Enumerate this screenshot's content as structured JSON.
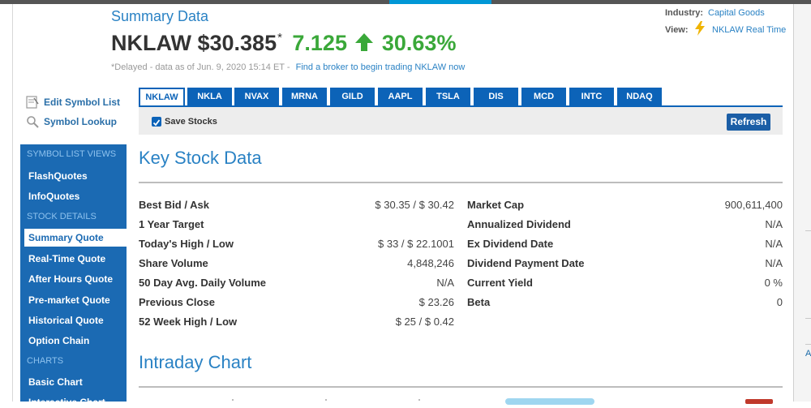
{
  "header": {
    "section_title": "Summary Data",
    "symbol_price": "NKLAW $30.385",
    "delayed_marker": "*",
    "change": "7.125",
    "change_pct": "30.63%",
    "delayed_text": "*Delayed - data as of Jun. 9, 2020 15:14 ET  -",
    "broker_link": "Find a broker to begin trading NKLAW now",
    "industry_label": "Industry:",
    "industry_value": "Capital Goods",
    "view_label": "View:",
    "view_value": "NKLAW Real Time",
    "change_color": "#3aa839"
  },
  "tools": {
    "edit_symbol_list": "Edit Symbol List",
    "symbol_lookup": "Symbol Lookup"
  },
  "nav": {
    "section1": "SYMBOL LIST VIEWS",
    "flashquotes": "FlashQuotes",
    "infoquotes": "InfoQuotes",
    "section2": "STOCK DETAILS",
    "summary_quote": "Summary Quote",
    "realtime_quote": "Real-Time Quote",
    "after_hours": "After Hours Quote",
    "premarket": "Pre-market Quote",
    "historical": "Historical Quote",
    "option_chain": "Option Chain",
    "section3": "CHARTS",
    "basic_chart": "Basic Chart",
    "interactive_chart": "Interactive Chart"
  },
  "tabs": [
    "NKLAW",
    "NKLA",
    "NVAX",
    "MRNA",
    "GILD",
    "AAPL",
    "TSLA",
    "DIS",
    "MCD",
    "INTC",
    "NDAQ"
  ],
  "save_stocks": {
    "label": "Save Stocks",
    "checked": true,
    "refresh": "Refresh"
  },
  "key_stock": {
    "title": "Key Stock Data",
    "left": [
      {
        "label": "Best Bid / Ask",
        "value": "$ 30.35 / $ 30.42"
      },
      {
        "label": "1 Year Target",
        "value": ""
      },
      {
        "label": "Today's High / Low",
        "value": "$ 33 / $ 22.1001"
      },
      {
        "label": "Share Volume",
        "value": "4,848,246"
      },
      {
        "label": "50 Day Avg. Daily Volume",
        "value": "N/A"
      },
      {
        "label": "Previous Close",
        "value": "$ 23.26"
      },
      {
        "label": "52 Week High / Low",
        "value": "$ 25 / $ 0.42"
      }
    ],
    "right": [
      {
        "label": "Market Cap",
        "value": "900,611,400"
      },
      {
        "label": "Annualized Dividend",
        "value": "N/A"
      },
      {
        "label": "Ex Dividend Date",
        "value": "N/A"
      },
      {
        "label": "Dividend Payment Date",
        "value": "N/A"
      },
      {
        "label": "Current Yield",
        "value": "0 %"
      },
      {
        "label": "Beta",
        "value": "0"
      }
    ]
  },
  "intraday": {
    "title": "Intraday Chart"
  }
}
